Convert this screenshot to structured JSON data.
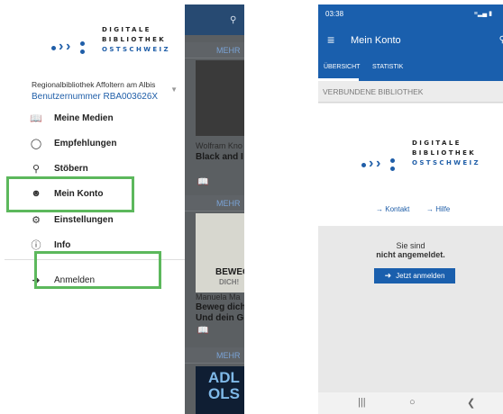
{
  "left": {
    "background": {
      "mehr": "MEHR",
      "author1": "Wolfram Kno",
      "title1": "Black and I",
      "cover2_title": "BEWEG",
      "cover2_sub": "DICH!",
      "author2": "Manuela Ma",
      "title2_line1": "Beweg dich",
      "title2_line2": "Und dein G",
      "cover3_line1": "ADL",
      "cover3_line2": "OLS"
    },
    "logo": {
      "line1": "DIGITALE",
      "line2": "BIBLIOTHEK",
      "line3": "OSTSCHWEIZ"
    },
    "library": {
      "name": "Regionalbibliothek Affoltern am Albis",
      "user": "Benutzernummer RBA003626X"
    },
    "nav": {
      "meine_medien": "Meine Medien",
      "empfehlungen": "Empfehlungen",
      "stoebern": "Stöbern",
      "mein_konto": "Mein Konto",
      "einstellungen": "Einstellungen",
      "info": "Info",
      "anmelden": "Anmelden"
    }
  },
  "right": {
    "status": {
      "time": "03:38",
      "right": "≡▂▄ ▮"
    },
    "app_title": "Mein Konto",
    "tabs": {
      "overview": "ÜBERSICHT",
      "stats": "STATISTIK"
    },
    "section": "VERBUNDENE BIBLIOTHEK",
    "logo": {
      "line1": "DIGITALE",
      "line2": "BIBLIOTHEK",
      "line3": "OSTSCHWEIZ"
    },
    "links": {
      "kontakt": "Kontakt",
      "hilfe": "Hilfe"
    },
    "message": {
      "line1": "Sie sind",
      "line2": "nicht angemeldet."
    },
    "login_button": "Jetzt anmelden"
  },
  "colors": {
    "primary": "#1a5fad",
    "highlight": "#5cb85c"
  }
}
